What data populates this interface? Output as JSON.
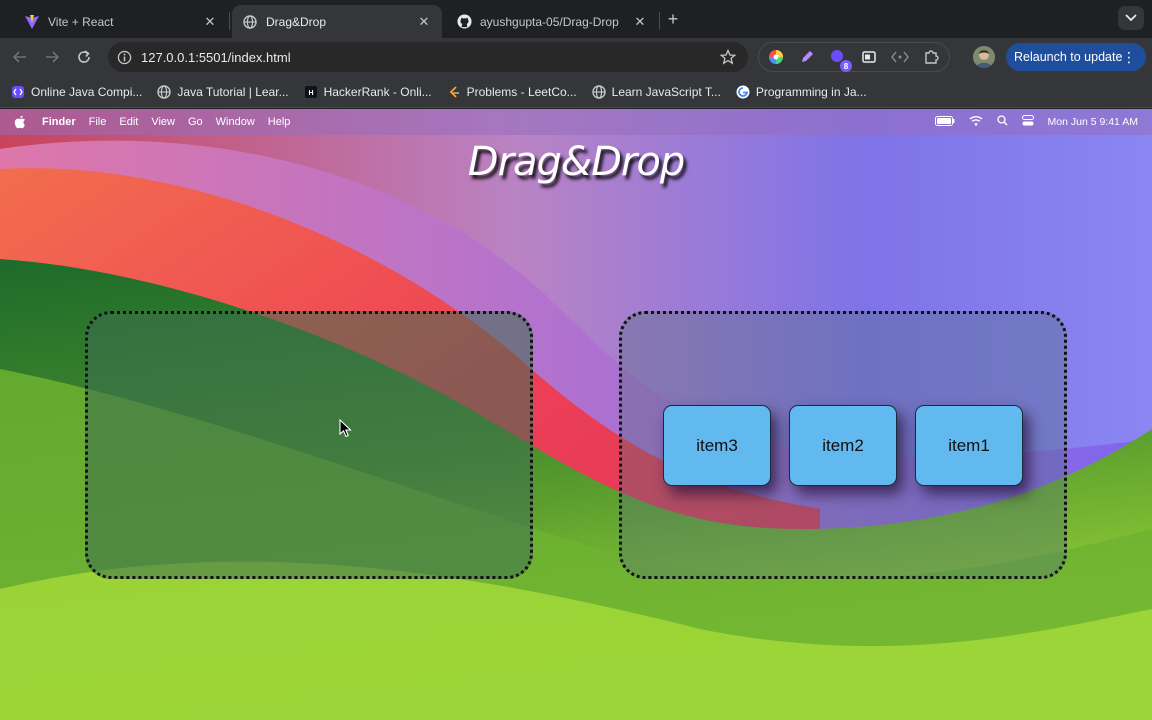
{
  "tabs": [
    {
      "title": "Vite + React",
      "icon": "vite-icon",
      "active": false
    },
    {
      "title": "Drag&Drop",
      "icon": "globe-icon",
      "active": true
    },
    {
      "title": "ayushgupta-05/Drag-Drop",
      "icon": "github-icon",
      "active": false
    }
  ],
  "toolbar": {
    "url": "127.0.0.1:5501/index.html",
    "relaunch_label": "Relaunch to update",
    "extension_badge": "8"
  },
  "bookmarks": [
    {
      "label": "Online Java Compi...",
      "icon": "code-icon"
    },
    {
      "label": "Java Tutorial | Lear...",
      "icon": "globe-icon"
    },
    {
      "label": "HackerRank - Onli...",
      "icon": "hackerrank-icon"
    },
    {
      "label": "Problems - LeetCo...",
      "icon": "leetcode-icon"
    },
    {
      "label": "Learn JavaScript T...",
      "icon": "globe-icon"
    },
    {
      "label": "Programming in Ja...",
      "icon": "google-icon"
    }
  ],
  "menubar": {
    "items": [
      "Finder",
      "File",
      "Edit",
      "View",
      "Go",
      "Window",
      "Help"
    ],
    "datetime": "Mon Jun 5  9:41 AM"
  },
  "page": {
    "heading": "Drag&Drop",
    "items": [
      "item3",
      "item2",
      "item1"
    ]
  },
  "colors": {
    "item_bg": "#62b9f0",
    "relaunch_bg": "#1f4e9c"
  }
}
